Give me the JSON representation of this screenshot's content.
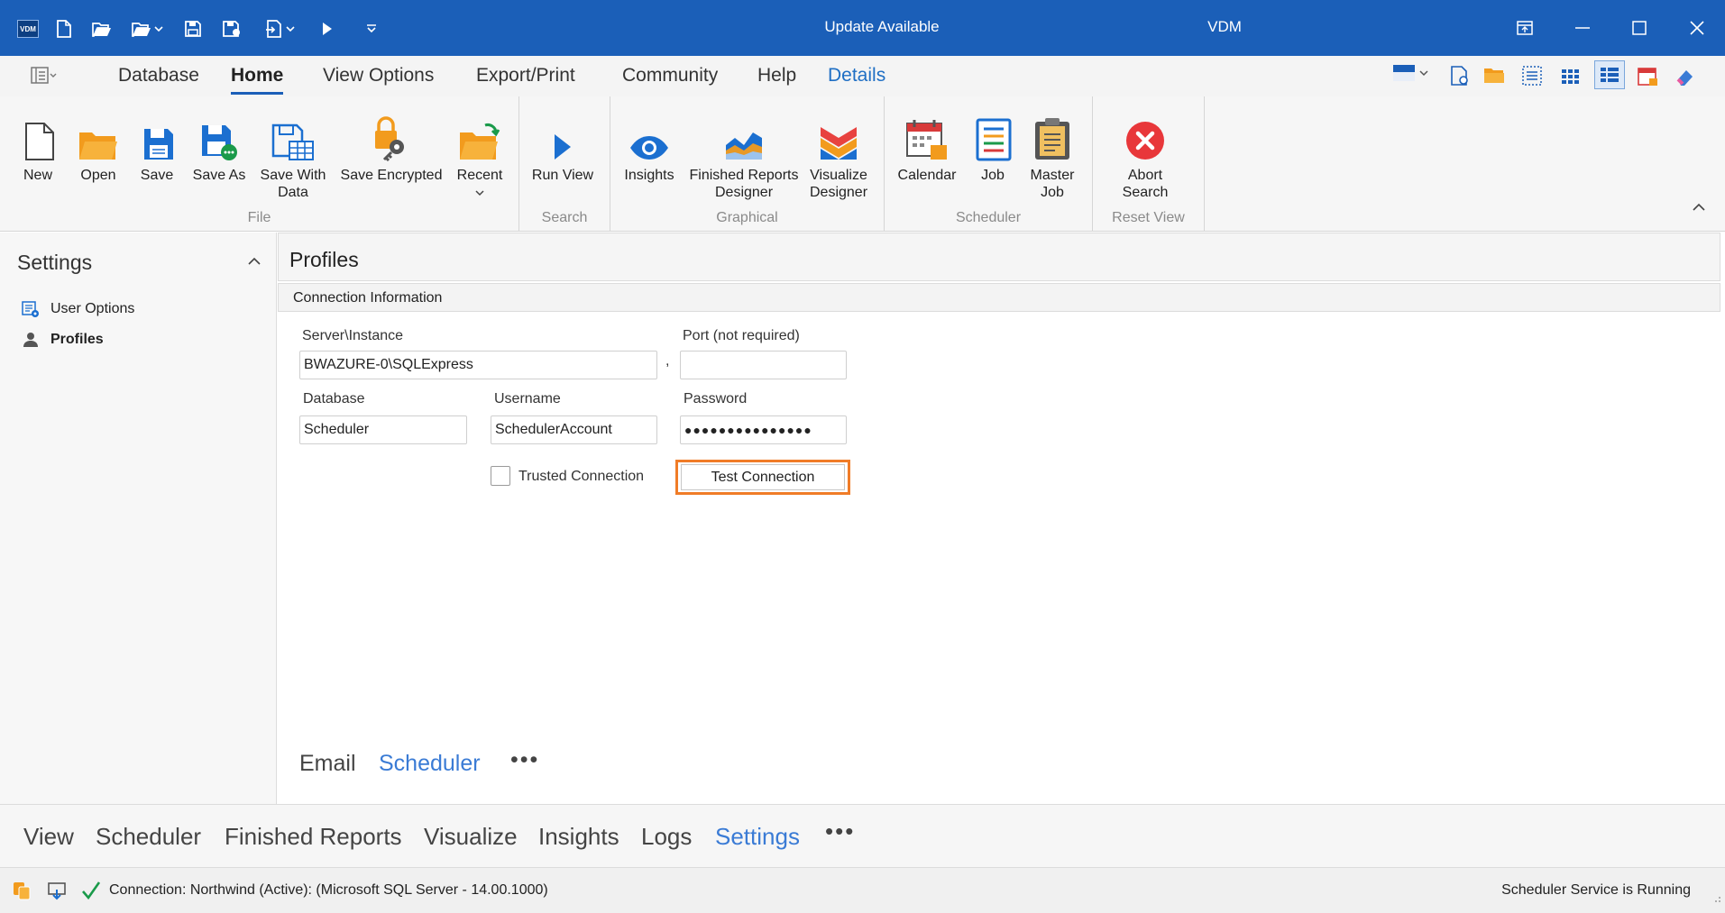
{
  "titlebar": {
    "app_badge": "VDM",
    "center_text": "Update Available",
    "app_title": "VDM",
    "quick_access": [
      "new-icon",
      "open-icon",
      "open-recent-icon",
      "save-icon",
      "save-as-icon",
      "export-icon",
      "run-icon",
      "customize-icon"
    ],
    "window_buttons": [
      "restore-panel-icon",
      "minimize-icon",
      "maximize-icon",
      "close-icon"
    ],
    "color": "#1b5fb8"
  },
  "menu": {
    "tabs": [
      {
        "label": "Database"
      },
      {
        "label": "Home"
      },
      {
        "label": "View Options"
      },
      {
        "label": "Export/Print"
      },
      {
        "label": "Community"
      },
      {
        "label": "Help"
      },
      {
        "label": "Details"
      }
    ],
    "active_tab": "Home",
    "contextual_tab": "Details"
  },
  "ribbon": {
    "file": {
      "label": "File",
      "buttons": {
        "new": "New",
        "open": "Open",
        "save": "Save",
        "save_as": "Save As",
        "save_with_data_1": "Save With",
        "save_with_data_2": "Data",
        "save_encrypted": "Save Encrypted",
        "recent": "Recent"
      }
    },
    "search": {
      "label": "Search",
      "run_view": "Run View"
    },
    "graphical": {
      "label": "Graphical",
      "insights": "Insights",
      "finished_reports_1": "Finished Reports",
      "finished_reports_2": "Designer",
      "visualize_1": "Visualize",
      "visualize_2": "Designer"
    },
    "scheduler": {
      "label": "Scheduler",
      "calendar": "Calendar",
      "job": "Job",
      "master_job_1": "Master",
      "master_job_2": "Job"
    },
    "reset_view": {
      "label": "Reset View",
      "abort_1": "Abort",
      "abort_2": "Search"
    }
  },
  "left_pane": {
    "title": "Settings",
    "items": [
      {
        "label": "User Options",
        "icon": "user-options-icon"
      },
      {
        "label": "Profiles",
        "icon": "person-icon",
        "selected": true
      }
    ]
  },
  "profiles": {
    "title": "Profiles",
    "section": "Connection Information",
    "server_label": "Server\\Instance",
    "server_value": "BWAZURE-0\\SQLExpress",
    "port_label": "Port (not required)",
    "port_value": "",
    "database_label": "Database",
    "database_value": "Scheduler",
    "username_label": "Username",
    "username_value": "SchedulerAccount",
    "password_label": "Password",
    "password_value": "●●●●●●●●●●●●●●●",
    "trusted_label": "Trusted Connection",
    "trusted_checked": false,
    "test_button": "Test Connection",
    "highlight_color": "#f07c27"
  },
  "sub_tabs": {
    "items": [
      "Email",
      "Scheduler"
    ],
    "active": "Scheduler",
    "more": "•••"
  },
  "bottom_nav": {
    "items": [
      "View",
      "Scheduler",
      "Finished Reports",
      "Visualize",
      "Insights",
      "Logs",
      "Settings"
    ],
    "active": "Settings",
    "more": "•••"
  },
  "status": {
    "connection": "Connection: Northwind (Active): (Microsoft SQL Server - 14.00.1000)",
    "service": "Scheduler Service is Running",
    "check_color": "#1a9a4a"
  }
}
